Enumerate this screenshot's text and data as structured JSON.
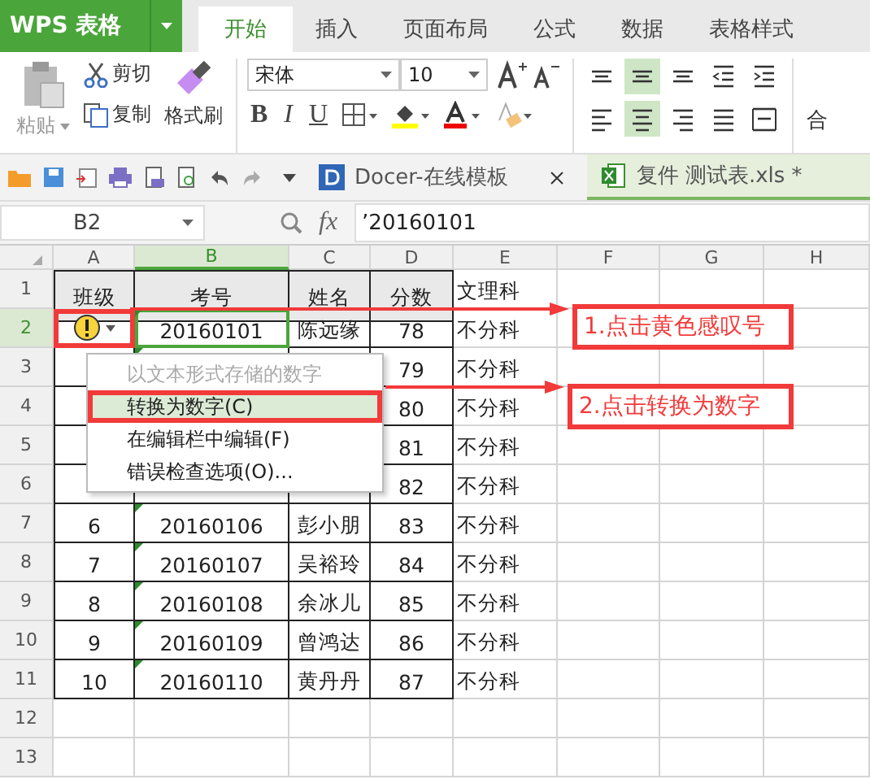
{
  "app_button": {
    "label": "WPS 表格"
  },
  "tabs": [
    {
      "label": "开始",
      "selected": true
    },
    {
      "label": "插入",
      "selected": false
    },
    {
      "label": "页面布局",
      "selected": false
    },
    {
      "label": "公式",
      "selected": false
    },
    {
      "label": "数据",
      "selected": false
    },
    {
      "label": "表格样式",
      "selected": false
    }
  ],
  "clipboard": {
    "paste": "粘贴",
    "cut": "剪切",
    "copy": "复制",
    "format_painter": "格式刷"
  },
  "font": {
    "name": "宋体",
    "size": "10"
  },
  "format_buttons": [
    {
      "label": "B",
      "kind": "bold"
    },
    {
      "label": "I",
      "kind": "italic"
    },
    {
      "label": "U",
      "kind": "underline"
    }
  ],
  "align_rows": [
    [
      {
        "kind": "top",
        "selected": false
      },
      {
        "kind": "middle",
        "selected": true
      },
      {
        "kind": "bottom",
        "selected": false
      },
      {
        "kind": "outdent",
        "selected": false
      },
      {
        "kind": "indent",
        "selected": false
      }
    ],
    [
      {
        "kind": "left",
        "selected": false
      },
      {
        "kind": "center",
        "selected": true
      },
      {
        "kind": "right",
        "selected": false
      },
      {
        "kind": "justify",
        "selected": false
      },
      {
        "kind": "distributed",
        "selected": false
      }
    ]
  ],
  "merge_button": {
    "label": "合"
  },
  "doc_tabs": [
    {
      "label": "Docer-在线模板",
      "selected": false,
      "kind": "docer"
    },
    {
      "label": "复件 测试表.xls *",
      "selected": true,
      "kind": "sheet"
    }
  ],
  "formula_bar": {
    "cell_ref": "B2",
    "fx_label": "fx",
    "formula": "’20160101"
  },
  "sheet": {
    "columns": [
      {
        "label": "A",
        "selected": false
      },
      {
        "label": "B",
        "selected": true
      },
      {
        "label": "C",
        "selected": false
      },
      {
        "label": "D",
        "selected": false
      },
      {
        "label": "E",
        "selected": false
      },
      {
        "label": "F",
        "selected": false
      },
      {
        "label": "G",
        "selected": false
      },
      {
        "label": "H",
        "selected": false
      }
    ],
    "rows": [
      {
        "label": "1",
        "selected": false,
        "A": "班级",
        "B": "考号",
        "C": "姓名",
        "D": "分数",
        "E": "文理科"
      },
      {
        "label": "2",
        "selected": true,
        "error_indicator": true,
        "text_number_flag": true,
        "B": "20160101",
        "C": "陈远缘",
        "D": "78",
        "E": "不分科"
      },
      {
        "label": "3",
        "selected": false,
        "text_number_flag": true,
        "D": "79",
        "E": "不分科"
      },
      {
        "label": "4",
        "selected": false,
        "D": "80",
        "E": "不分科"
      },
      {
        "label": "5",
        "selected": false,
        "D": "81",
        "E": "不分科"
      },
      {
        "label": "6",
        "selected": false,
        "D": "82",
        "E": "不分科"
      },
      {
        "label": "7",
        "selected": false,
        "text_number_flag": true,
        "A": "6",
        "B": "20160106",
        "C": "彭小朋",
        "D": "83",
        "E": "不分科"
      },
      {
        "label": "8",
        "selected": false,
        "text_number_flag": true,
        "A": "7",
        "B": "20160107",
        "C": "吴裕玲",
        "D": "84",
        "E": "不分科"
      },
      {
        "label": "9",
        "selected": false,
        "text_number_flag": true,
        "A": "8",
        "B": "20160108",
        "C": "余冰儿",
        "D": "85",
        "E": "不分科"
      },
      {
        "label": "10",
        "selected": false,
        "text_number_flag": true,
        "A": "9",
        "B": "20160109",
        "C": "曾鸿达",
        "D": "86",
        "E": "不分科"
      },
      {
        "label": "11",
        "selected": false,
        "text_number_flag": true,
        "A": "10",
        "B": "20160110",
        "C": "黄丹丹",
        "D": "87",
        "E": "不分科"
      },
      {
        "label": "12",
        "selected": false
      },
      {
        "label": "13",
        "selected": false
      }
    ]
  },
  "context_menu": {
    "items": [
      {
        "label": "以文本形式存储的数字",
        "disabled": true,
        "selected": false
      },
      {
        "label": "转换为数字(C)",
        "disabled": false,
        "selected": true
      },
      {
        "label": "在编辑栏中编辑(F)",
        "disabled": false,
        "selected": false
      },
      {
        "label": "错误检查选项(O)...",
        "disabled": false,
        "selected": false
      }
    ]
  },
  "annotations": [
    {
      "label": "1.点击黄色感叹号"
    },
    {
      "label": "2.点击转换为数字"
    }
  ]
}
